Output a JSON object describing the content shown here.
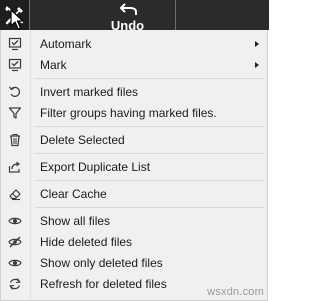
{
  "toolbar": {
    "tools_icon": "tools-icon",
    "undo_icon": "undo-icon",
    "undo_label": "Undo"
  },
  "menu": {
    "items": [
      {
        "label": "Automark",
        "icon": "check-square-icon",
        "submenu": true
      },
      {
        "label": "Mark",
        "icon": "check-square-icon",
        "submenu": true
      },
      {
        "label": "Invert marked files",
        "icon": "circular-arrow-icon",
        "submenu": false
      },
      {
        "label": "Filter groups having marked files.",
        "icon": "funnel-icon",
        "submenu": false
      },
      {
        "label": "Delete Selected",
        "icon": "trash-icon",
        "submenu": false
      },
      {
        "label": "Export Duplicate List",
        "icon": "export-icon",
        "submenu": false
      },
      {
        "label": "Clear Cache",
        "icon": "eraser-icon",
        "submenu": false
      },
      {
        "label": "Show all files",
        "icon": "eye-icon",
        "submenu": false
      },
      {
        "label": "Hide deleted files",
        "icon": "eye-slash-icon",
        "submenu": false
      },
      {
        "label": "Show only deleted files",
        "icon": "eye-icon",
        "submenu": false
      },
      {
        "label": "Refresh for deleted files",
        "icon": "refresh-icon",
        "submenu": false
      }
    ]
  },
  "watermark": "wsxdn.com",
  "colors": {
    "toolbar_bg": "#2b2b2b",
    "menu_bg": "#f0f0f0",
    "icon": "#3a3a3a"
  }
}
